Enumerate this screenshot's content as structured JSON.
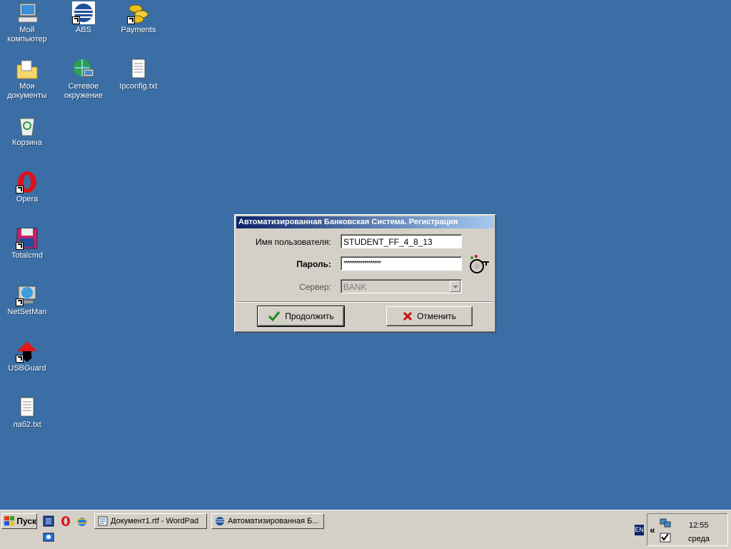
{
  "desktop": {
    "icons": [
      {
        "label": "Мой\nкомпьютер",
        "icon": "my-computer-icon"
      },
      {
        "label": "ABS",
        "icon": "abs-globe-icon"
      },
      {
        "label": "Payments",
        "icon": "coins-icon"
      },
      {
        "label": "Мои\nдокументы",
        "icon": "my-documents-icon"
      },
      {
        "label": "Сетевое\nокружение",
        "icon": "network-icon"
      },
      {
        "label": "Ipconfig.txt",
        "icon": "text-file-icon"
      },
      {
        "label": "Корзина",
        "icon": "recycle-bin-icon"
      },
      {
        "label": "Opera",
        "icon": "opera-icon"
      },
      {
        "label": "Totalcmd",
        "icon": "floppy-icon"
      },
      {
        "label": "NetSetMan",
        "icon": "netsetman-icon"
      },
      {
        "label": "USBGuard",
        "icon": "usbguard-icon"
      },
      {
        "label": "лаб2.txt",
        "icon": "text-file-icon"
      }
    ]
  },
  "dialog": {
    "title": "Автоматизированная Банковская Система. Регистрация",
    "username_label": "Имя пользователя:",
    "username_value": "STUDENT_FF_4_8_13",
    "password_label": "Пароль:",
    "password_value": "******************",
    "server_label": "Сервер:",
    "server_value": "BANK",
    "continue_label": "Продолжить",
    "cancel_label": "Отменить"
  },
  "taskbar": {
    "start_label": "Пуск",
    "tasks": [
      {
        "label": "Документ1.rtf - WordPad"
      },
      {
        "label": "Автоматизированная Б..."
      }
    ],
    "tray": {
      "lang": "EN",
      "time": "12:55",
      "day": "среда",
      "chevron": "«"
    }
  },
  "colors": {
    "desktop": "#3a6ea5",
    "title_start": "#0a246a",
    "title_end": "#a6caf0",
    "face": "#d4d0c8"
  }
}
